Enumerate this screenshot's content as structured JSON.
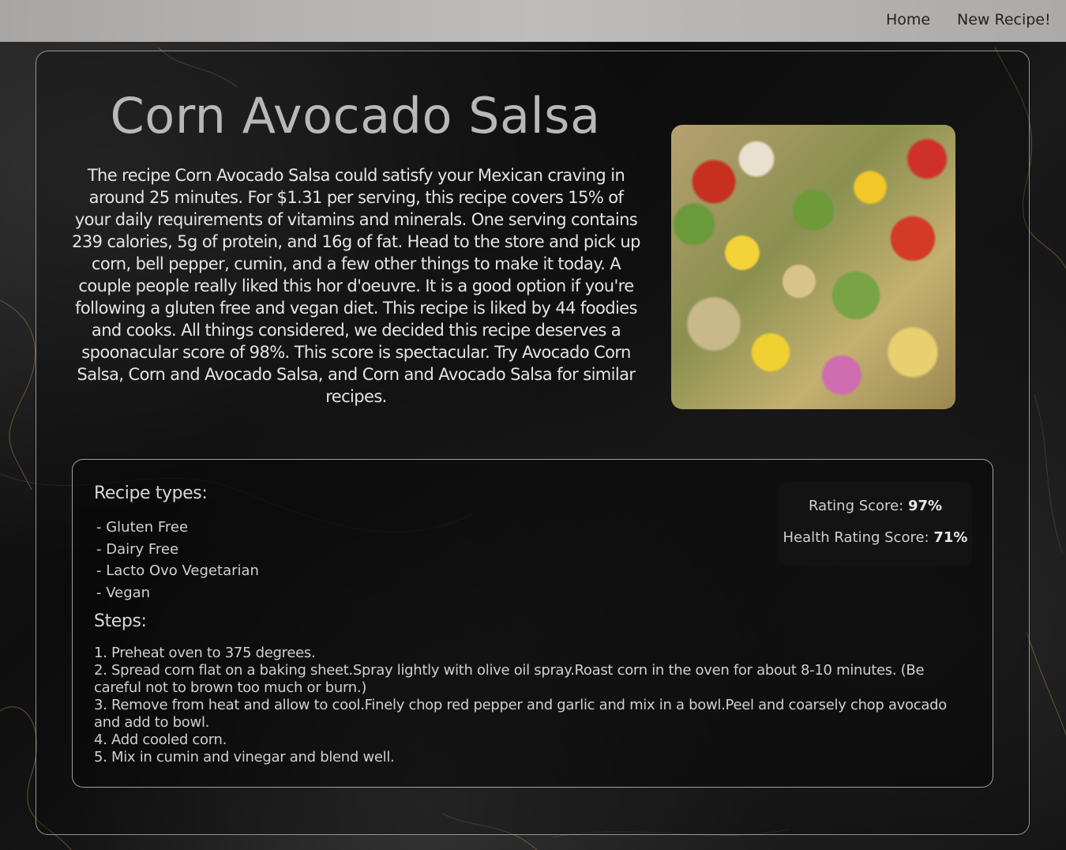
{
  "nav": {
    "home": "Home",
    "new_recipe": "New Recipe!"
  },
  "recipe": {
    "title": "Corn Avocado Salsa",
    "summary": "The recipe Corn Avocado Salsa could satisfy your Mexican craving in around 25 minutes. For $1.31 per serving, this recipe covers 15% of your daily requirements of vitamins and minerals. One serving contains 239 calories, 5g of protein, and 16g of fat. Head to the store and pick up corn, bell pepper, cumin, and a few other things to make it today. A couple people really liked this hor d'oeuvre. It is a good option if you're following a gluten free and vegan diet. This recipe is liked by 44 foodies and cooks. All things considered, we decided this recipe deserves a spoonacular score of 98%. This score is spectacular. Try Avocado Corn Salsa, Corn and Avocado Salsa, and Corn and Avocado Salsa for similar recipes."
  },
  "details": {
    "types_heading": "Recipe types:",
    "types": [
      "- Gluten Free",
      "- Dairy Free",
      "- Lacto Ovo Vegetarian",
      "- Vegan"
    ],
    "steps_heading": "Steps:",
    "steps": [
      "1. Preheat oven to 375 degrees.",
      "2. Spread corn flat on a baking sheet.Spray lightly with olive oil spray.Roast corn in the oven for about 8-10 minutes. (Be careful not to brown too much or burn.)",
      "3. Remove from heat and allow to cool.Finely chop red pepper and garlic and mix in a bowl.Peel and coarsely chop avocado and add to bowl.",
      "4. Add cooled corn.",
      "5. Mix in cumin and vinegar and blend well."
    ]
  },
  "scores": {
    "rating_label": "Rating Score: ",
    "rating_value": "97%",
    "health_label": "Health Rating Score: ",
    "health_value": "71%"
  }
}
